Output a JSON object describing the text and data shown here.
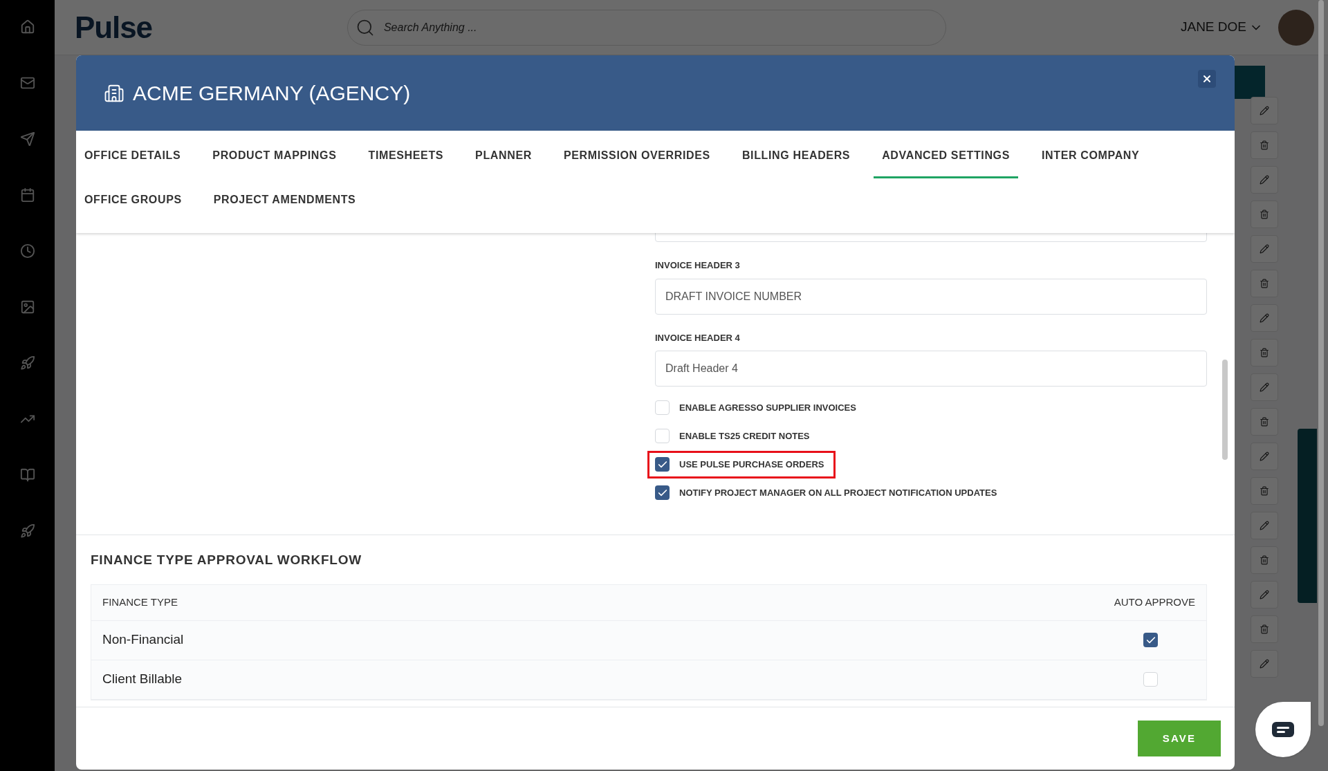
{
  "app": {
    "logo": "Pulse",
    "search": {
      "placeholder": "Search Anything ..."
    },
    "user": {
      "name": "JANE DOE"
    }
  },
  "dialog": {
    "title": "ACME GERMANY (AGENCY)",
    "tabs": [
      {
        "label": "OFFICE DETAILS",
        "selected": false
      },
      {
        "label": "PRODUCT MAPPINGS",
        "selected": false
      },
      {
        "label": "TIMESHEETS",
        "selected": false
      },
      {
        "label": "PLANNER",
        "selected": false
      },
      {
        "label": "PERMISSION OVERRIDES",
        "selected": false
      },
      {
        "label": "BILLING HEADERS",
        "selected": false
      },
      {
        "label": "ADVANCED SETTINGS",
        "selected": true
      },
      {
        "label": "INTER COMPANY",
        "selected": false
      },
      {
        "label": "OFFICE GROUPS",
        "selected": false
      },
      {
        "label": "PROJECT AMENDMENTS",
        "selected": false
      }
    ],
    "fields": [
      {
        "label": "INVOICE HEADER 3",
        "value": "DRAFT INVOICE NUMBER"
      },
      {
        "label": "INVOICE HEADER 4",
        "value": "Draft Header 4"
      }
    ],
    "options": [
      {
        "label": "ENABLE AGRESSO SUPPLIER INVOICES",
        "checked": false,
        "highlighted": false
      },
      {
        "label": "ENABLE TS25 CREDIT NOTES",
        "checked": false,
        "highlighted": false
      },
      {
        "label": "USE PULSE PURCHASE ORDERS",
        "checked": true,
        "highlighted": true
      },
      {
        "label": "NOTIFY PROJECT MANAGER ON ALL PROJECT NOTIFICATION UPDATES",
        "checked": true,
        "highlighted": false
      }
    ],
    "workflow": {
      "title": "FINANCE TYPE APPROVAL WORKFLOW",
      "columns": [
        "FINANCE TYPE",
        "AUTO APPROVE"
      ],
      "rows": [
        {
          "name": "Non-Financial",
          "auto_approve": true
        },
        {
          "name": "Client Billable",
          "auto_approve": false
        }
      ]
    },
    "save_button": "SAVE"
  }
}
